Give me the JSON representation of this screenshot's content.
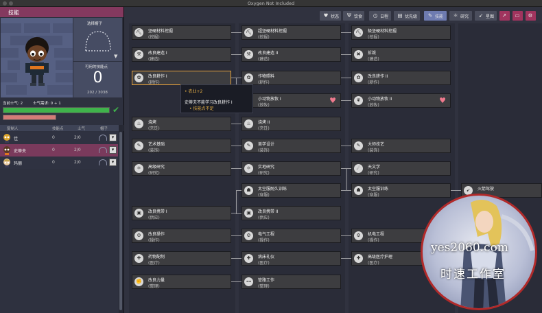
{
  "window": {
    "title": "Oxygen Not Included"
  },
  "left_panel": {
    "tab_label": "技能",
    "hat_label": "选择帽子",
    "points_label": "可用的技能点",
    "points_value": "0",
    "xp_progress": "202 / 3038",
    "morale_label": "当前士气: 2",
    "morale_need_label": "士气需求: 0 + 1",
    "morale_current": 2,
    "morale_need": 1,
    "table_headers": [
      "复制人",
      "技能点",
      "士气",
      "帽子"
    ],
    "dupes": [
      {
        "name": "佳",
        "points": "0",
        "morale": "2/0"
      },
      {
        "name": "史蒂夫",
        "points": "0",
        "morale": "2/0"
      },
      {
        "name": "玛丽",
        "points": "0",
        "morale": "2/0"
      }
    ]
  },
  "toolbar": {
    "buttons": [
      {
        "label": "状态",
        "icon": "heart-icon"
      },
      {
        "label": "饮食",
        "icon": "cutlery-icon"
      },
      {
        "label": "日程",
        "icon": "clock-icon"
      },
      {
        "label": "优先级",
        "icon": "priority-icon"
      },
      {
        "label": "技能",
        "icon": "wrench-icon"
      },
      {
        "label": "研究",
        "icon": "research-icon"
      },
      {
        "label": "星图",
        "icon": "rocket-icon"
      },
      {
        "label": "",
        "icon": "trend-icon"
      },
      {
        "label": "",
        "icon": "book-icon"
      },
      {
        "label": "",
        "icon": "gear-icon"
      }
    ]
  },
  "skills": {
    "col1": [
      {
        "name": "坚硬材料挖掘",
        "group": "(挖掘)"
      },
      {
        "name": "改良建造 I",
        "group": "(建造)"
      },
      {
        "name": "改良耕作 I",
        "group": "(耕作)"
      },
      {
        "name": "烧烤",
        "group": "(烹饪)"
      },
      {
        "name": "艺术基础",
        "group": "(装饰)"
      },
      {
        "name": "高级研究",
        "group": "(研究)"
      },
      {
        "name": "改良携带 I",
        "group": "(供应)"
      },
      {
        "name": "改良操作",
        "group": "(操作)"
      },
      {
        "name": "药物配制",
        "group": "(医疗)"
      },
      {
        "name": "改良力量",
        "group": "(整理)"
      }
    ],
    "col2": [
      {
        "name": "超坚硬材料挖掘",
        "group": "(挖掘)"
      },
      {
        "name": "改良建造 II",
        "group": "(建造)"
      },
      {
        "name": "作物照料",
        "group": "(耕作)"
      },
      {
        "name": "小动物放牧 I",
        "group": "(放牧)"
      },
      {
        "name": "烧烤 II",
        "group": "(烹饪)"
      },
      {
        "name": "美学设计",
        "group": "(装饰)"
      },
      {
        "name": "实地研究",
        "group": "(研究)"
      },
      {
        "name": "太空服耐久训练",
        "group": "(穿服)"
      },
      {
        "name": "改良携带 II",
        "group": "(供应)"
      },
      {
        "name": "电气工程",
        "group": "(操作)"
      },
      {
        "name": "病床礼仪",
        "group": "(医疗)"
      },
      {
        "name": "管路工作",
        "group": "(整理)"
      }
    ],
    "col3": [
      {
        "name": "极坚硬材料挖掘",
        "group": "(挖掘)"
      },
      {
        "name": "拆毁",
        "group": "(建造)"
      },
      {
        "name": "改良耕作 II",
        "group": "(耕作)"
      },
      {
        "name": "小动物放牧 II",
        "group": "(放牧)"
      },
      {
        "name": "大师技艺",
        "group": "(装饰)"
      },
      {
        "name": "天文学",
        "group": "(研究)"
      },
      {
        "name": "太空服训练",
        "group": "(穿服)"
      },
      {
        "name": "机电工程",
        "group": "(操作)"
      },
      {
        "name": "高级医疗护理",
        "group": "(医疗)"
      }
    ],
    "col4": [
      {
        "name": "火箭驾驶",
        "group": ""
      }
    ]
  },
  "tooltip": {
    "line1": "• 农业+2",
    "line2": "史蒂夫不能学习改良耕作 I",
    "line3": "• 技能点不足"
  },
  "watermark": {
    "url_text": "yes2060.com",
    "studio_text": "时速工作室"
  },
  "colors": {
    "accent_tab": "#84395f",
    "active_tab": "#6e7bb0",
    "morale_green": "#3fb34b",
    "morale_red": "#d47c78"
  }
}
